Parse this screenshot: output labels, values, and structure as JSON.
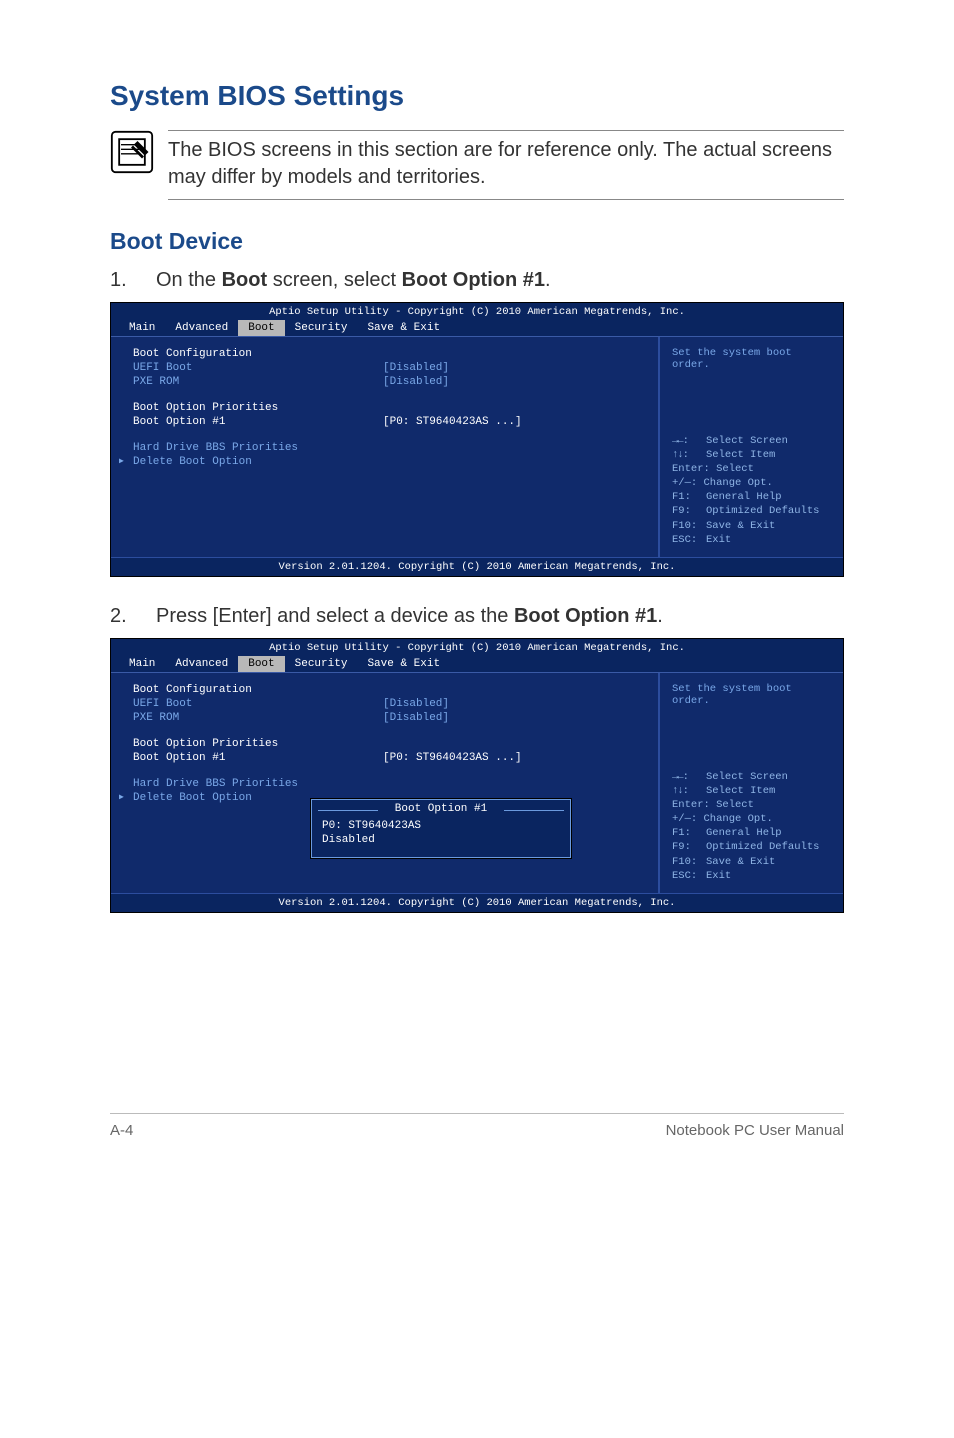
{
  "title": "System BIOS Settings",
  "note": "The BIOS screens in this section are for reference only. The actual screens may differ by models and territories.",
  "subtitle": "Boot Device",
  "step1": {
    "num": "1.",
    "pre": "On the ",
    "b1": "Boot",
    "mid": " screen, select ",
    "b2": "Boot Option #1",
    "post": "."
  },
  "step2": {
    "num": "2.",
    "pre": "Press [Enter] and select a device as the ",
    "b1": "Boot Option #1",
    "post": "."
  },
  "bios": {
    "header": "Aptio Setup Utility - Copyright (C) 2010 American Megatrends, Inc.",
    "tabs": [
      "Main",
      "Advanced",
      "Boot",
      "Security",
      "Save & Exit"
    ],
    "left": {
      "boot_config": "Boot Configuration",
      "uefi_label": "UEFI Boot",
      "uefi_value": "[Disabled]",
      "pxe_label": "PXE ROM",
      "pxe_value": "[Disabled]",
      "priorities": "Boot Option Priorities",
      "opt1_label": "Boot Option #1",
      "opt1_value": "[P0: ST9640423AS   ...]",
      "hdd_priorities": "Hard Drive BBS Priorities",
      "delete": "Delete Boot Option"
    },
    "right_top": "Set the system boot order.",
    "help": {
      "l1a": "→←:",
      "l1b": "Select Screen",
      "l2a": "↑↓:",
      "l2b": "Select Item",
      "l3": "Enter: Select",
      "l4": "+/—:  Change Opt.",
      "l5a": "F1:",
      "l5b": "General Help",
      "l6a": "F9:",
      "l6b": "Optimized Defaults",
      "l7a": "F10:",
      "l7b": "Save & Exit",
      "l8a": "ESC:",
      "l8b": "Exit"
    },
    "footer": "Version 2.01.1204. Copyright (C) 2010 American Megatrends, Inc.",
    "popup": {
      "title": "Boot Option #1",
      "items": [
        "P0: ST9640423AS",
        "Disabled"
      ]
    }
  },
  "footer": {
    "left": "A-4",
    "right": "Notebook PC User Manual"
  }
}
